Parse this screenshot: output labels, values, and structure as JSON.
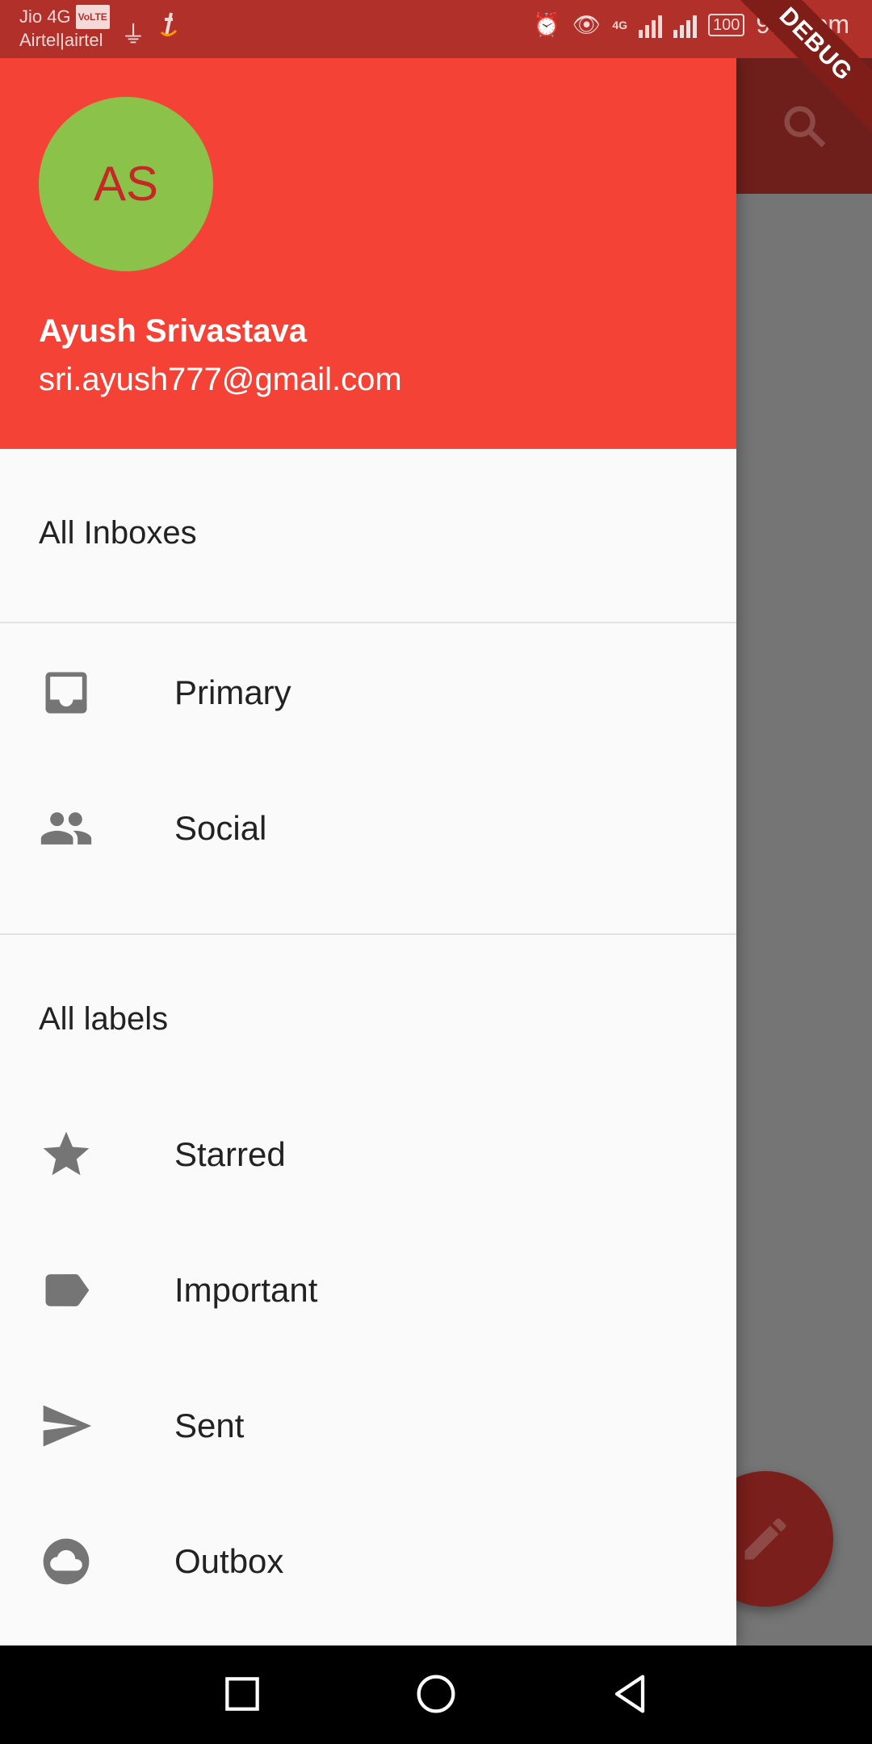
{
  "status_bar": {
    "carrier_line1": "Jio 4G",
    "volte_badge": "VoLTE",
    "carrier_line2": "Airtel|airtel",
    "signal_tag": "4G",
    "battery": "100",
    "time": "9:52 pm"
  },
  "debug_banner": "DEBUG",
  "drawer": {
    "avatar_initials": "AS",
    "account_name": "Ayush Srivastava",
    "account_email": "sri.ayush777@gmail.com",
    "section_inboxes": "All Inboxes",
    "inbox_items": [
      {
        "label": "Primary",
        "icon": "inbox-icon"
      },
      {
        "label": "Social",
        "icon": "people-icon"
      }
    ],
    "section_labels": "All labels",
    "label_items": [
      {
        "label": "Starred",
        "icon": "star-icon"
      },
      {
        "label": "Important",
        "icon": "label-icon"
      },
      {
        "label": "Sent",
        "icon": "send-icon"
      },
      {
        "label": "Outbox",
        "icon": "cloud-icon"
      }
    ]
  },
  "colors": {
    "drawer_header": "#f44336",
    "avatar_bg": "#8bc34a",
    "avatar_text": "#c62828",
    "status_bar": "#b1302a",
    "scrim": "#757575"
  }
}
